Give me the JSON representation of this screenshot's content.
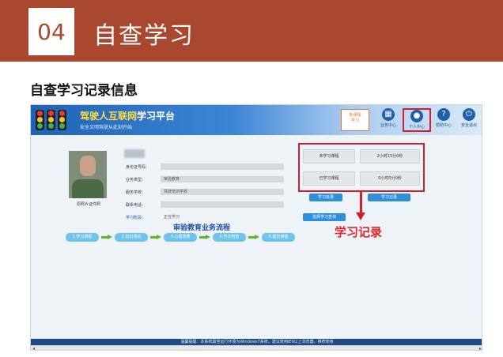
{
  "slide": {
    "number": "04",
    "title": "自查学习",
    "subtitle": "自查学习记录信息",
    "annotation": "学习记录"
  },
  "portal": {
    "brand_highlight": "驾驶人互联网",
    "brand_rest": "学习平台",
    "brand_sub": "安全文明驾驶从此刻开始",
    "nav": {
      "new_label": "新课程",
      "new_sub": "学习",
      "items": [
        {
          "label": "业务中心",
          "icon": "grid-icon"
        },
        {
          "label": "个人中心",
          "icon": "user-icon"
        },
        {
          "label": "帮助中心",
          "icon": "help-icon"
        },
        {
          "label": "安全退出",
          "icon": "power-icon"
        }
      ]
    },
    "photo_caption": "原照片证件照",
    "fields": [
      {
        "label": "身份证号码：",
        "value": ""
      },
      {
        "label": "业务类型：",
        "value": "审验教育"
      },
      {
        "label": "服务学校：",
        "value": "驾驶培训学校"
      },
      {
        "label": "联系电话：",
        "value": ""
      },
      {
        "label": "学习阶段：",
        "value": "正在学习"
      }
    ],
    "stats": {
      "unlearned_label": "未学习课程",
      "unlearned_value": "2小时15分0秒",
      "learned_label": "已学习课程",
      "learned_value": "0小时0分0秒"
    },
    "buttons": {
      "study": "学习目录",
      "record": "学习记录",
      "query": "选择学习查询"
    },
    "flow": {
      "title": "审验教育业务流程",
      "steps": [
        "1.学习课程",
        "2.知识测试",
        "3.心理测量",
        "4.学习自查",
        "5.提交审验"
      ]
    },
    "footer": "温馨提醒：本系统最佳运行环境为Windows7系统，建议使用IE9以上浏览器，推荐使用"
  }
}
